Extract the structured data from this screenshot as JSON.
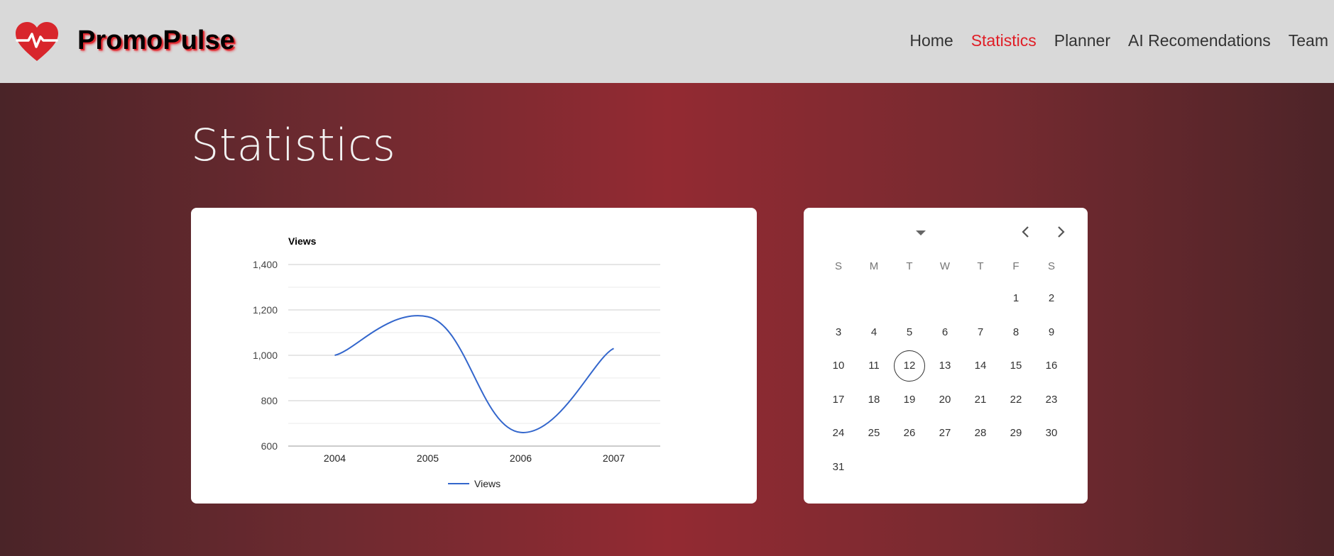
{
  "header": {
    "brand": "PromoPulse",
    "logo_icon": "heart-pulse-icon",
    "nav": [
      {
        "label": "Home",
        "active": false
      },
      {
        "label": "Statistics",
        "active": true
      },
      {
        "label": "Planner",
        "active": false
      },
      {
        "label": "AI Recomendations",
        "active": false
      },
      {
        "label": "Team",
        "active": false
      }
    ],
    "accent_color": "#e01e26"
  },
  "page": {
    "title": "Statistics"
  },
  "chart_data": {
    "type": "line",
    "title": "Views",
    "x": [
      "2004",
      "2005",
      "2006",
      "2007"
    ],
    "series": [
      {
        "name": "Views",
        "values": [
          1000,
          1170,
          660,
          1030
        ],
        "color": "#3366cc"
      }
    ],
    "ylim": [
      600,
      1400
    ],
    "yticks": [
      "600",
      "800",
      "1,000",
      "1,200",
      "1,400"
    ],
    "grid": true,
    "legend_position": "bottom"
  },
  "calendar": {
    "weekdays": [
      "S",
      "M",
      "T",
      "W",
      "T",
      "F",
      "S"
    ],
    "first_weekday_offset": 5,
    "days_in_month": 31,
    "today": 12,
    "prev_icon": "chevron-left-icon",
    "next_icon": "chevron-right-icon",
    "dropdown_icon": "caret-down-icon"
  }
}
